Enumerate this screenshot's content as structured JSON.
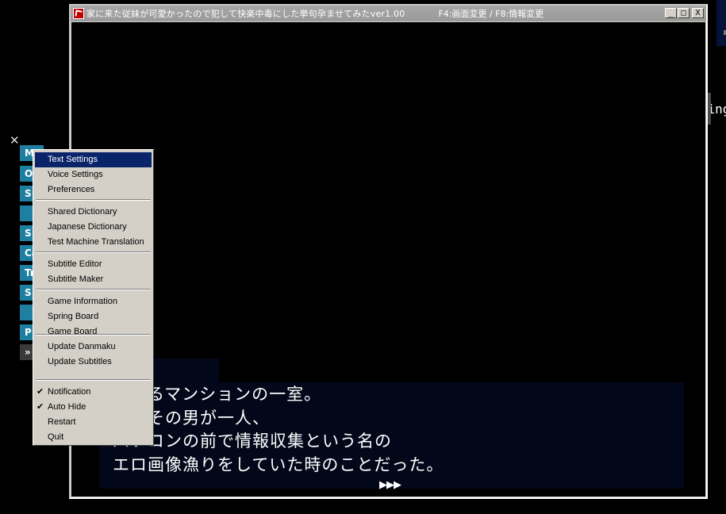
{
  "window": {
    "title": "家に来た従妹が可愛かったので犯して快楽中毒にした挙句孕ませてみたver1.00",
    "hint": "F4:画面変更 / F8:情報変更",
    "minimize": "_",
    "maximize": "□",
    "close": "X"
  },
  "dialogue": {
    "lines": [
      "とあるマンションの一室。",
      "私はその男が一人、",
      "パソコンの前で情報収集という名の",
      "エロ画像漁りをしていた時のことだった。"
    ],
    "next_indicator": "▶▶▶"
  },
  "overlay": {
    "loading": "Loading",
    "close_glyph": "✕"
  },
  "side_buttons": [
    "M",
    "O",
    "S",
    "",
    "S",
    "Ca",
    "Tr",
    "S",
    "",
    "P",
    "»"
  ],
  "context_menu": {
    "groups": [
      [
        {
          "label": "Text Settings",
          "selected": true
        },
        {
          "label": "Voice Settings"
        },
        {
          "label": "Preferences"
        }
      ],
      [
        {
          "label": "Shared Dictionary"
        },
        {
          "label": "Japanese Dictionary"
        },
        {
          "label": "Test Machine Translation"
        }
      ],
      [
        {
          "label": "Subtitle Editor"
        },
        {
          "label": "Subtitle Maker"
        }
      ],
      [
        {
          "label": "Game Information"
        },
        {
          "label": "Spring Board"
        },
        {
          "label": "Game Board"
        }
      ],
      [
        {
          "label": "Update Danmaku"
        },
        {
          "label": "Update Subtitles"
        }
      ],
      [
        {
          "label": "Notification",
          "checked": true
        },
        {
          "label": "Auto Hide",
          "checked": true
        },
        {
          "label": "Restart"
        },
        {
          "label": "Quit"
        }
      ]
    ],
    "check_glyph": "✔"
  },
  "colors": {
    "menu_selected": "#0a246a",
    "side_button": "#1f7fa0",
    "textbox": "#02081a"
  }
}
